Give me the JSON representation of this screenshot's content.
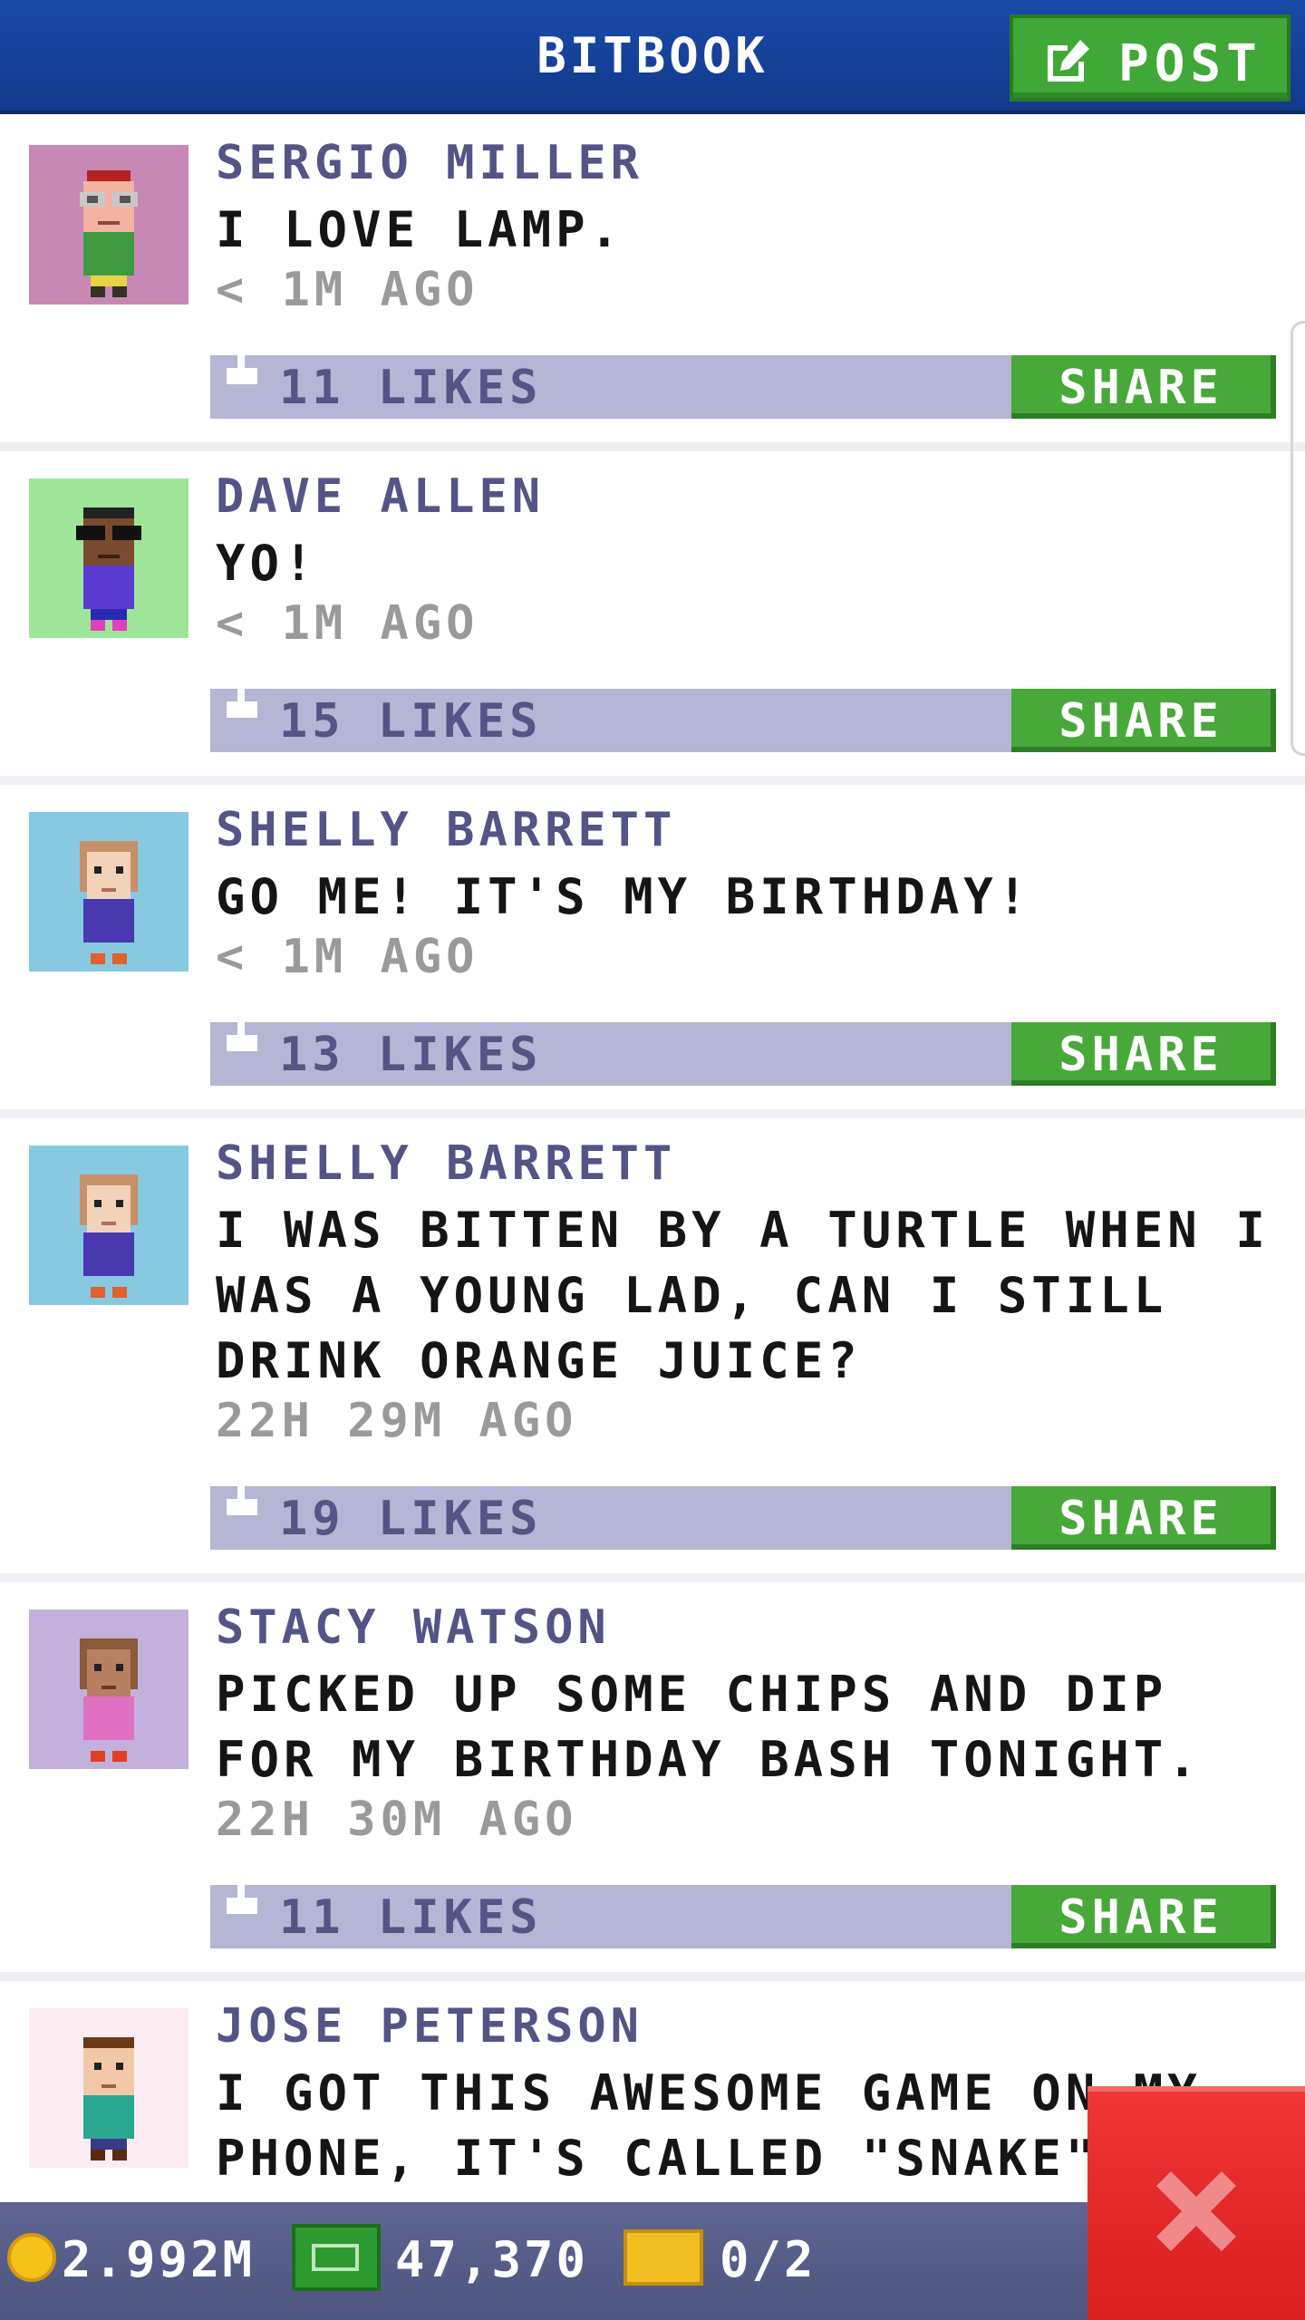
{
  "header": {
    "title": "BITBOOK",
    "post_label": "POST",
    "post_icon": "edit-icon"
  },
  "posts": [
    {
      "name": "SERGIO MILLER",
      "message": "I LOVE LAMP.",
      "time": "< 1M AGO",
      "likes": "11 LIKES",
      "share": "SHARE",
      "avatar_bg": "#c788b6"
    },
    {
      "name": "DAVE ALLEN",
      "message": "YO!",
      "time": "< 1M AGO",
      "likes": "15 LIKES",
      "share": "SHARE",
      "avatar_bg": "#9ee59a"
    },
    {
      "name": "SHELLY BARRETT",
      "message": "GO ME! IT'S MY BIRTHDAY!",
      "time": "< 1M AGO",
      "likes": "13 LIKES",
      "share": "SHARE",
      "avatar_bg": "#86c9e0"
    },
    {
      "name": "SHELLY BARRETT",
      "message": "I WAS BITTEN BY A TURTLE WHEN I WAS A YOUNG LAD, CAN I STILL DRINK ORANGE JUICE?",
      "time": "22H 29M AGO",
      "likes": "19 LIKES",
      "share": "SHARE",
      "avatar_bg": "#86c9e0"
    },
    {
      "name": "STACY WATSON",
      "message": "PICKED UP SOME CHIPS AND DIP FOR MY BIRTHDAY BASH TONIGHT.",
      "time": "22H 30M AGO",
      "likes": "11 LIKES",
      "share": "SHARE",
      "avatar_bg": "#c4b0dc"
    },
    {
      "name": "JOSE PETERSON",
      "message": "I GOT THIS AWESOME GAME ON MY PHONE, IT'S CALLED \"SNAKE\".",
      "time": "",
      "likes": "",
      "share": "",
      "avatar_bg": "#fcecf2"
    }
  ],
  "status_bar": {
    "coins": "2.992M",
    "bux": "47,370",
    "tickets": "0/2"
  },
  "colors": {
    "header": "#1a4aa8",
    "post_button": "#3fa836",
    "like_bar": "#b5b5d6",
    "share_button": "#48a83a",
    "name_text": "#545487",
    "close_button": "#e02828"
  },
  "icons": {
    "coin": "coin-icon",
    "bux": "cash-icon",
    "tickets": "ticket-icon",
    "close": "close-icon",
    "like": "thumbs-up-icon"
  }
}
